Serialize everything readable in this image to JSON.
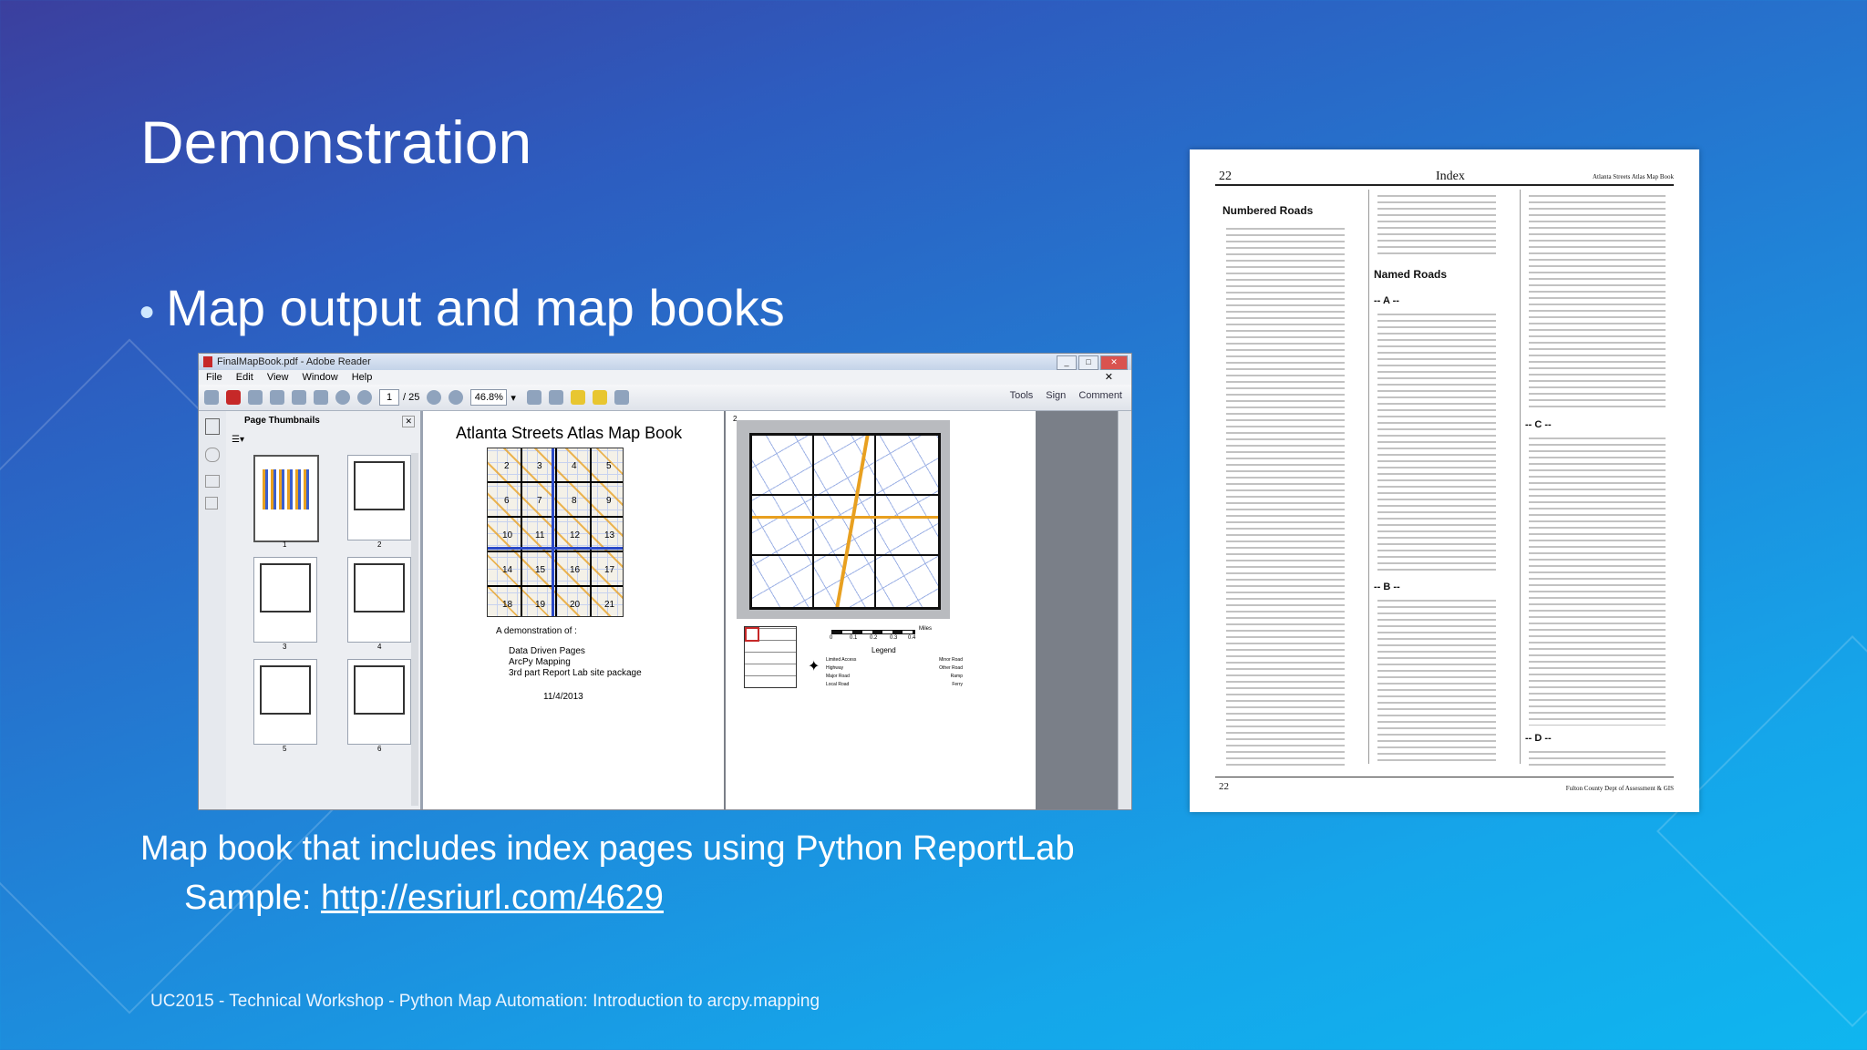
{
  "slide": {
    "title": "Demonstration",
    "bullet": "Map output and map books",
    "caption": "Map book that includes index pages using Python ReportLab",
    "sample_label": "Sample:",
    "sample_link": "http://esriurl.com/4629",
    "footer": "UC2015 - Technical Workshop - Python Map Automation: Introduction to arcpy.mapping"
  },
  "reader": {
    "window_title": "FinalMapBook.pdf - Adobe Reader",
    "menu": [
      "File",
      "Edit",
      "View",
      "Window",
      "Help"
    ],
    "page_current": "1",
    "page_total": "/ 25",
    "zoom": "46.8%",
    "tools": [
      "Tools",
      "Sign",
      "Comment"
    ],
    "panel_title": "Page Thumbnails",
    "thumb_labels": [
      "1",
      "2",
      "3",
      "4",
      "5",
      "6"
    ],
    "page1": {
      "title": "Atlanta Streets Atlas Map Book",
      "grid_numbers": [
        "2",
        "3",
        "4",
        "5",
        "6",
        "7",
        "8",
        "9",
        "10",
        "11",
        "12",
        "13",
        "14",
        "15",
        "16",
        "17",
        "18",
        "19",
        "20",
        "21"
      ],
      "demo_label": "A demonstration of :",
      "demo_items": [
        "Data Driven Pages",
        "ArcPy Mapping",
        "3rd part Report Lab site package"
      ],
      "date": "11/4/2013"
    },
    "page2": {
      "page_number": "2",
      "scale_label": "Miles",
      "scale_ticks": [
        "0",
        "0.1",
        "0.2",
        "0.3",
        "0.4"
      ],
      "legend_title": "Legend",
      "legend_items": [
        "Limited Access",
        "Minor Road",
        "Highway",
        "Other Road",
        "Major Road",
        "Ramp",
        "Local Road",
        "Ferry"
      ]
    }
  },
  "index_page": {
    "page_num": "22",
    "title": "Index",
    "header_right": "Atlanta Streets Atlas Map Book",
    "section_numbered": "Numbered Roads",
    "section_named": "Named Roads",
    "letters": [
      "-- A --",
      "-- B --",
      "-- C --",
      "-- D --"
    ],
    "footer_num": "22",
    "footer_right": "Fulton County Dept of Assessment & GIS"
  },
  "colors": {
    "accent_red": "#c62828",
    "highway_orange": "#e8a020",
    "road_blue": "#3a5fcd"
  }
}
